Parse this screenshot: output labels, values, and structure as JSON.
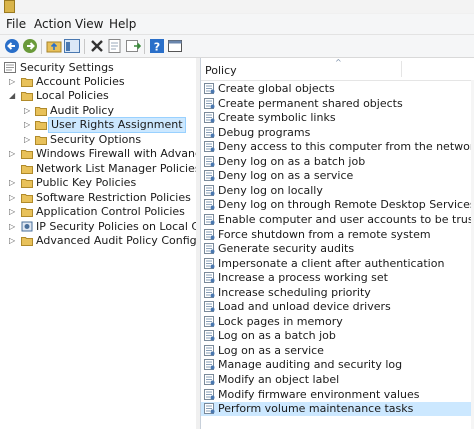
{
  "menu": {
    "file": "File",
    "action": "Action",
    "view": "View",
    "help": "Help"
  },
  "toolbar": {
    "icons": [
      "back-arrow-icon",
      "forward-arrow-icon",
      "up-folder-icon",
      "show-hide-tree-icon",
      "delete-icon",
      "properties-icon",
      "export-list-icon",
      "help-icon",
      "console-icon"
    ]
  },
  "tree": {
    "items": [
      {
        "label": "Security Settings"
      },
      {
        "label": "Account Policies"
      },
      {
        "label": "Local Policies"
      },
      {
        "label": "Audit Policy"
      },
      {
        "label": "User Rights Assignment"
      },
      {
        "label": "Security Options"
      },
      {
        "label": "Windows Firewall with Advanced Secu"
      },
      {
        "label": "Network List Manager Policies"
      },
      {
        "label": "Public Key Policies"
      },
      {
        "label": "Software Restriction Policies"
      },
      {
        "label": "Application Control Policies"
      },
      {
        "label": "IP Security Policies on Local Compute"
      },
      {
        "label": "Advanced Audit Policy Configuration"
      }
    ]
  },
  "policy_list": {
    "header": "Policy",
    "sort_indicator": "^",
    "items": [
      "Create global objects",
      "Create permanent shared objects",
      "Create symbolic links",
      "Debug programs",
      "Deny access to this computer from the network",
      "Deny log on as a batch job",
      "Deny log on as a service",
      "Deny log on locally",
      "Deny log on through Remote Desktop Services",
      "Enable computer and user accounts to be trusted for delega...",
      "Force shutdown from a remote system",
      "Generate security audits",
      "Impersonate a client after authentication",
      "Increase a process working set",
      "Increase scheduling priority",
      "Load and unload device drivers",
      "Lock pages in memory",
      "Log on as a batch job",
      "Log on as a service",
      "Manage auditing and security log",
      "Modify an object label",
      "Modify firmware environment values",
      "Perform volume maintenance tasks"
    ],
    "selected": "Perform volume maintenance tasks"
  },
  "colors": {
    "selection": "#cce8ff",
    "selection_text": "#ffffff",
    "folder": "#e8c15a"
  }
}
